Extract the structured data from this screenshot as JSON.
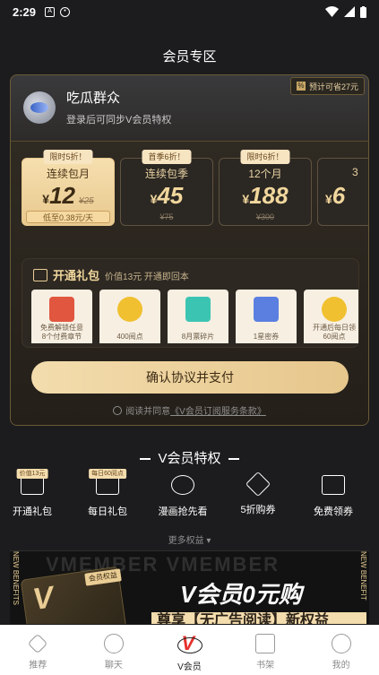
{
  "status_bar": {
    "time": "2:29"
  },
  "page": {
    "title": "会员专区"
  },
  "user": {
    "name": "吃瓜群众",
    "subtitle": "登录后可同步V会员特权"
  },
  "save_tag": "预计可省27元",
  "plans": [
    {
      "badge": "限时5折！",
      "name": "连续包月",
      "currency": "¥",
      "price": "12",
      "original": "¥25",
      "footer": "低至0.38元/天",
      "selected": true
    },
    {
      "badge": "首季6折！",
      "name": "连续包季",
      "currency": "¥",
      "price": "45",
      "original": "",
      "footer": "¥75",
      "selected": false
    },
    {
      "badge": "限时6折！",
      "name": "12个月",
      "currency": "¥",
      "price": "188",
      "original": "",
      "footer": "¥300",
      "selected": false
    },
    {
      "badge": "",
      "name": "3",
      "currency": "¥",
      "price": "6",
      "original": "",
      "footer": "",
      "selected": false
    }
  ],
  "gift": {
    "title": "开通礼包",
    "subtitle": "价值13元 开通即回本",
    "items": [
      {
        "label": "免费解锁任意\n8个付费章节",
        "color": "#e0563f"
      },
      {
        "label": "400阅点",
        "color": "#f0c030"
      },
      {
        "label": "8月票碎片",
        "color": "#3cc4b3"
      },
      {
        "label": "1星密券",
        "color": "#5a7fe0"
      },
      {
        "label": "开通后每日领\n60阅点",
        "color": "#f0c030"
      }
    ]
  },
  "pay_button": "确认协议并支付",
  "agreement": {
    "prefix": "阅读并同意",
    "link": "《V会员订阅服务条款》"
  },
  "privileges": {
    "title": "V会员特权",
    "items": [
      {
        "label": "开通礼包",
        "tag": "价值13元",
        "icon": "gift-box-icon"
      },
      {
        "label": "每日礼包",
        "tag": "每日60阅点",
        "icon": "daily-gift-icon"
      },
      {
        "label": "漫画抢先看",
        "tag": "",
        "icon": "eye-icon"
      },
      {
        "label": "5折购券",
        "tag": "",
        "icon": "coupon-50-icon"
      },
      {
        "label": "免费领券",
        "tag": "",
        "icon": "ticket-icon"
      }
    ],
    "more": "更多权益"
  },
  "banner": {
    "watermark": "VMEMBER VMEMBER",
    "side_text_left": "NEW BENEFITS",
    "side_text_right": "NEW BENEFIT",
    "card_letter": "V",
    "card_badge": "会员权益",
    "headline": "V会员0元购",
    "strip": "尊享【无广告阅读】新权益"
  },
  "tabs": [
    {
      "label": "推荐",
      "icon": "star-icon",
      "active": false
    },
    {
      "label": "聊天",
      "icon": "chat-icon",
      "active": false
    },
    {
      "label": "V会员",
      "icon": "vip-icon",
      "active": true
    },
    {
      "label": "书架",
      "icon": "bookshelf-icon",
      "active": false
    },
    {
      "label": "我的",
      "icon": "profile-icon",
      "active": false
    }
  ],
  "colors": {
    "gold": "#e9cd94",
    "accent_red": "#e5312c",
    "background": "#1c1c1e"
  }
}
